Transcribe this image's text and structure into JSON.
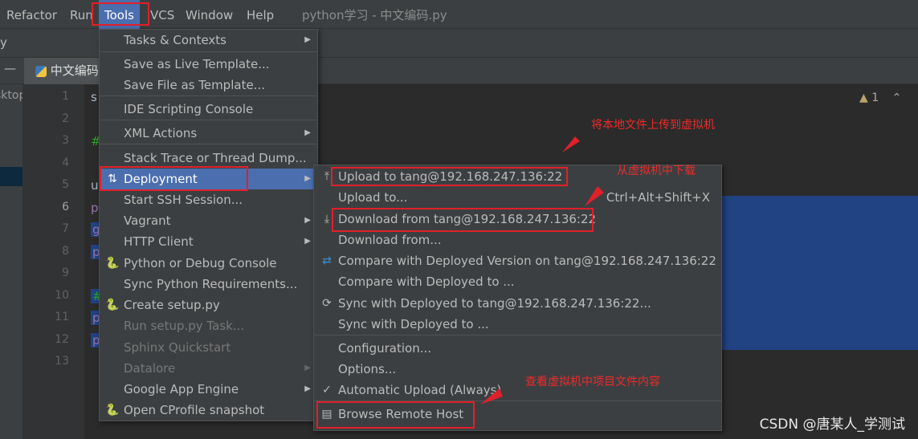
{
  "menubar": {
    "items": [
      "Refactor",
      "Run",
      "Tools",
      "VCS",
      "Window",
      "Help"
    ],
    "active": "Tools",
    "title": "python学习 - 中文编码.py"
  },
  "toolbar": {
    "fragment": "y"
  },
  "tab": {
    "label": "中文编码",
    "collapse": "—"
  },
  "leftpanel": {
    "fragment": "sktop"
  },
  "editor": {
    "line_numbers": [
      "1",
      "2",
      "3",
      "4",
      "5",
      "6",
      "7",
      "8",
      "9",
      "10",
      "11",
      "12",
      "13"
    ],
    "current_line": "6",
    "code_fragments": {
      "1": "s",
      "3": "#",
      "5": "u",
      "6": "p",
      "7": "g",
      "8": "p",
      "10": "#",
      "11": "p",
      "12": "p"
    },
    "warnings": "1"
  },
  "tools_menu": {
    "items": [
      {
        "label": "Tasks & Contexts",
        "submenu": true
      },
      {
        "label": "Save as Live Template..."
      },
      {
        "label": "Save File as Template..."
      },
      {
        "label": "IDE Scripting Console"
      },
      {
        "label": "XML Actions",
        "submenu": true
      },
      {
        "label": "Stack Trace or Thread Dump..."
      },
      {
        "label": "Deployment",
        "submenu": true,
        "icon": "deployment-icon",
        "highlighted": true
      },
      {
        "label": "Start SSH Session..."
      },
      {
        "label": "Vagrant",
        "submenu": true
      },
      {
        "label": "HTTP Client",
        "submenu": true
      },
      {
        "label": "Python or Debug Console",
        "icon": "python-icon"
      },
      {
        "label": "Sync Python Requirements..."
      },
      {
        "label": "Create setup.py",
        "icon": "python-file-icon"
      },
      {
        "label": "Run setup.py Task...",
        "disabled": true
      },
      {
        "label": "Sphinx Quickstart",
        "disabled": true
      },
      {
        "label": "Datalore",
        "submenu": true,
        "disabled": true
      },
      {
        "label": "Google App Engine",
        "submenu": true
      },
      {
        "label": "Open CProfile snapshot",
        "icon": "cprofile-icon"
      }
    ]
  },
  "deployment_menu": {
    "items": [
      {
        "label": "Upload to tang@192.168.247.136:22",
        "icon": "upload-icon"
      },
      {
        "label": "Upload to...",
        "shortcut": "Ctrl+Alt+Shift+X"
      },
      {
        "label": "Download from tang@192.168.247.136:22",
        "icon": "download-icon"
      },
      {
        "label": "Download from..."
      },
      {
        "label": "Compare with Deployed Version on tang@192.168.247.136:22",
        "icon": "compare-icon"
      },
      {
        "label": "Compare with Deployed to ..."
      },
      {
        "label": "Sync with Deployed to tang@192.168.247.136:22...",
        "icon": "sync-icon"
      },
      {
        "label": "Sync with Deployed to ..."
      },
      {
        "label": "Configuration..."
      },
      {
        "label": "Options..."
      },
      {
        "label": "Automatic Upload (Always)",
        "icon": "check-icon"
      },
      {
        "label": "Browse Remote Host",
        "icon": "server-icon"
      }
    ]
  },
  "annotations": {
    "upload_note": "将本地文件上传到虚拟机",
    "download_note": "从虚拟机中下载",
    "browse_note": "查看虚拟机中项目文件内容",
    "color": "#e0202a"
  },
  "watermark": "CSDN @唐某人_学测试"
}
